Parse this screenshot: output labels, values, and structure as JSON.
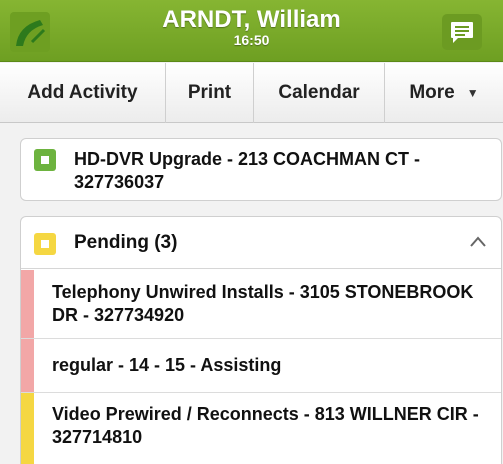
{
  "header": {
    "title": "ARNDT, William",
    "time": "16:50",
    "logo_icon": "brand-logo-icon",
    "chat_icon": "chat-bubble-icon",
    "background_color": "#7aab2a"
  },
  "toolbar": {
    "buttons": [
      {
        "label": "Add Activity"
      },
      {
        "label": "Print"
      },
      {
        "label": "Calendar"
      },
      {
        "label": "More",
        "icon": "caret-down-icon"
      }
    ]
  },
  "current_activity": {
    "title": "HD-DVR Upgrade - 213 COACHMAN CT - 327736037",
    "status_color": "#6db33f"
  },
  "pending": {
    "title": "Pending (3)",
    "status_color": "#f5d742",
    "expanded": true,
    "items": [
      {
        "text": "Telephony Unwired Installs - 3105 STONEBROOK DR - 327734920",
        "bar_color": "#f2a7a7"
      },
      {
        "text": "regular - 14 - 15 - Assisting",
        "bar_color": "#f2a7a7"
      },
      {
        "text": "Video Prewired / Reconnects - 813 WILLNER CIR - 327714810",
        "bar_color": "#f5d742"
      }
    ]
  }
}
